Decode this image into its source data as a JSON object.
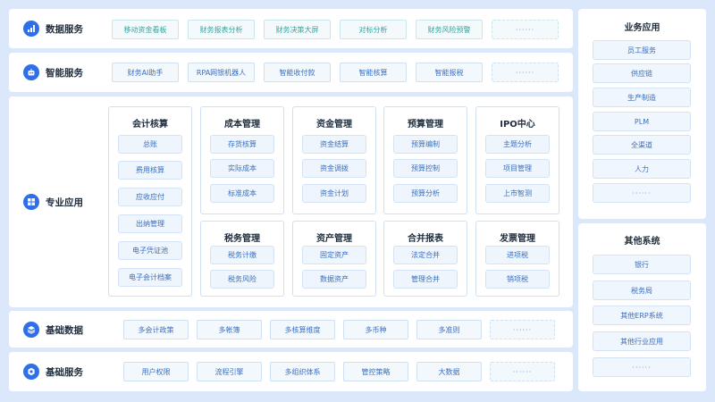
{
  "rows": [
    {
      "key": "data_service",
      "label": "数据服务",
      "icon": "bar-chart-icon",
      "chips": [
        "移动资金看板",
        "财务报表分析",
        "财务决策大屏",
        "对标分析",
        "财务风险预警",
        "······"
      ]
    },
    {
      "key": "smart_service",
      "label": "智能服务",
      "icon": "robot-icon",
      "chips": [
        "财务AI助手",
        "RPA网银机器人",
        "智能收付款",
        "智能核算",
        "智能报税",
        "······"
      ]
    },
    {
      "key": "professional_app",
      "label": "专业应用",
      "icon": "grid-icon",
      "chips": []
    },
    {
      "key": "base_data",
      "label": "基础数据",
      "icon": "layers-icon",
      "chips": [
        "多会计政策",
        "多帐簿",
        "多核算维度",
        "多币种",
        "多准则",
        "······"
      ]
    },
    {
      "key": "base_service",
      "label": "基础服务",
      "icon": "gear-icon",
      "chips": [
        "用户权限",
        "流程引擎",
        "多组织体系",
        "管控策略",
        "大数据",
        "······"
      ]
    }
  ],
  "modules": [
    {
      "title": "会计核算",
      "items": [
        "总账",
        "费用核算",
        "应收应付",
        "出纳管理",
        "电子凭证池",
        "电子会计档案"
      ]
    },
    {
      "title": "成本管理",
      "items": [
        "存货核算",
        "实际成本",
        "标准成本"
      ]
    },
    {
      "title": "资金管理",
      "items": [
        "资金结算",
        "资金调拨",
        "资金计划"
      ]
    },
    {
      "title": "预算管理",
      "items": [
        "预算编制",
        "预算控制",
        "预算分析"
      ]
    },
    {
      "title": "IPO中心",
      "items": [
        "主题分析",
        "项目管理",
        "上市智测"
      ]
    },
    {
      "title": "税务管理",
      "items": [
        "税务计缴",
        "税务风险"
      ]
    },
    {
      "title": "资产管理",
      "items": [
        "固定资产",
        "数据资产"
      ]
    },
    {
      "title": "合并报表",
      "items": [
        "法定合并",
        "管理合并"
      ]
    },
    {
      "title": "发票管理",
      "items": [
        "进项税",
        "销项税"
      ]
    }
  ],
  "business_apps": {
    "title": "业务应用",
    "items": [
      "员工服务",
      "供应链",
      "生产制造",
      "PLM",
      "全渠道",
      "人力",
      "······"
    ]
  },
  "other_systems": {
    "title": "其他系统",
    "items": [
      "银行",
      "税务局",
      "其他ERP系统",
      "其他行业应用",
      "······"
    ]
  },
  "colors": {
    "background": "#dbe7fb",
    "icon_blue": "#2f6fe8",
    "chip_text_blue": "#3a6fbf",
    "chip_text_teal": "#36a3a1",
    "card_border": "#cfe0f3"
  }
}
